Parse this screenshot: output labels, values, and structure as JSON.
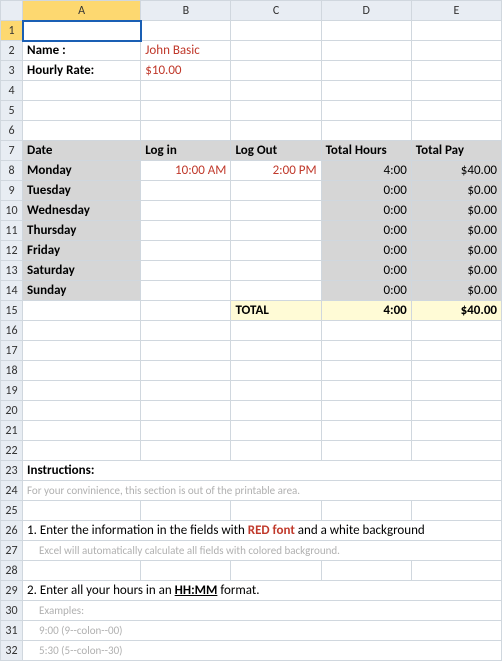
{
  "columns": [
    "A",
    "B",
    "C",
    "D",
    "E"
  ],
  "selected": {
    "col": "A",
    "row": 1
  },
  "labels": {
    "name": "Name :",
    "rate": "Hourly Rate:"
  },
  "values": {
    "name": "John Basic",
    "rate": "$10.00"
  },
  "table": {
    "headers": {
      "date": "Date",
      "login": "Log in",
      "logout": "Log Out",
      "hours": "Total Hours",
      "pay": "Total Pay"
    },
    "days": [
      {
        "day": "Monday",
        "login": "10:00 AM",
        "logout": "2:00 PM",
        "hours": "4:00",
        "pay": "$40.00"
      },
      {
        "day": "Tuesday",
        "login": "",
        "logout": "",
        "hours": "0:00",
        "pay": "$0.00"
      },
      {
        "day": "Wednesday",
        "login": "",
        "logout": "",
        "hours": "0:00",
        "pay": "$0.00"
      },
      {
        "day": "Thursday",
        "login": "",
        "logout": "",
        "hours": "0:00",
        "pay": "$0.00"
      },
      {
        "day": "Friday",
        "login": "",
        "logout": "",
        "hours": "0:00",
        "pay": "$0.00"
      },
      {
        "day": "Saturday",
        "login": "",
        "logout": "",
        "hours": "0:00",
        "pay": "$0.00"
      },
      {
        "day": "Sunday",
        "login": "",
        "logout": "",
        "hours": "0:00",
        "pay": "$0.00"
      }
    ],
    "total": {
      "label": "TOTAL",
      "hours": "4:00",
      "pay": "$40.00"
    }
  },
  "instructions": {
    "heading": "Instructions:",
    "note": "For your convinience, this section is out of the printable area.",
    "step1a": "1. Enter the information in the fields with ",
    "step1b": "RED font",
    "step1c": " and a white background",
    "step1note": "Excel will automatically calculate all fields with colored background.",
    "step2a": "2. Enter all your hours in an ",
    "step2b": "HH:MM",
    "step2c": " format.",
    "examples_label": "Examples:",
    "ex1": "9:00 (9--colon--00)",
    "ex2": "5:30 (5--colon--30)"
  },
  "chart_data": {
    "type": "table",
    "title": "Weekly Timesheet",
    "columns": [
      "Date",
      "Log in",
      "Log Out",
      "Total Hours",
      "Total Pay"
    ],
    "rows": [
      [
        "Monday",
        "10:00 AM",
        "2:00 PM",
        "4:00",
        "$40.00"
      ],
      [
        "Tuesday",
        "",
        "",
        "0:00",
        "$0.00"
      ],
      [
        "Wednesday",
        "",
        "",
        "0:00",
        "$0.00"
      ],
      [
        "Thursday",
        "",
        "",
        "0:00",
        "$0.00"
      ],
      [
        "Friday",
        "",
        "",
        "0:00",
        "$0.00"
      ],
      [
        "Saturday",
        "",
        "",
        "0:00",
        "$0.00"
      ],
      [
        "Sunday",
        "",
        "",
        "0:00",
        "$0.00"
      ]
    ],
    "total_row": [
      "",
      "",
      "TOTAL",
      "4:00",
      "$40.00"
    ]
  }
}
